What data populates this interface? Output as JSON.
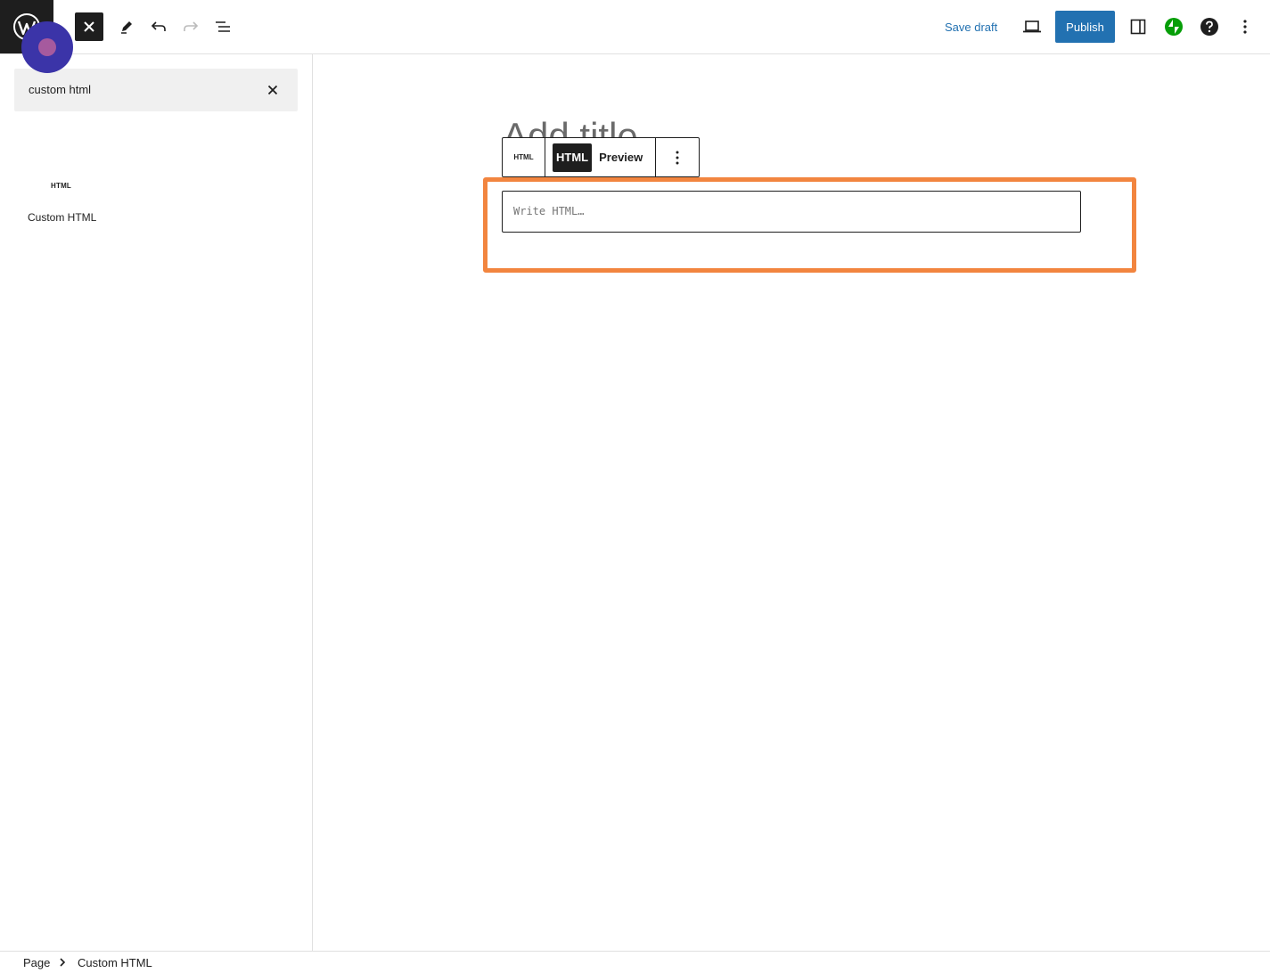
{
  "toolbar": {
    "save_draft": "Save draft",
    "publish": "Publish"
  },
  "inserter": {
    "search_value": "custom html",
    "result_icon": "HTML",
    "result_label": "Custom HTML"
  },
  "editor": {
    "title_placeholder": "Add title",
    "block_type_icon": "HTML",
    "tab_html": "HTML",
    "tab_preview": "Preview",
    "html_placeholder": "Write HTML…"
  },
  "breadcrumb": {
    "root": "Page",
    "current": "Custom HTML"
  },
  "colors": {
    "accent": "#2271b1",
    "highlight": "#f2853f",
    "jetpack": "#069e08",
    "dark": "#1e1e1e"
  },
  "icons": [
    "wordpress-logo-icon",
    "close-icon",
    "pen-icon",
    "undo-icon",
    "redo-icon",
    "list-view-icon",
    "desktop-preview-icon",
    "settings-sidebar-icon",
    "jetpack-icon",
    "help-icon",
    "more-vertical-icon",
    "chevron-right-icon"
  ]
}
